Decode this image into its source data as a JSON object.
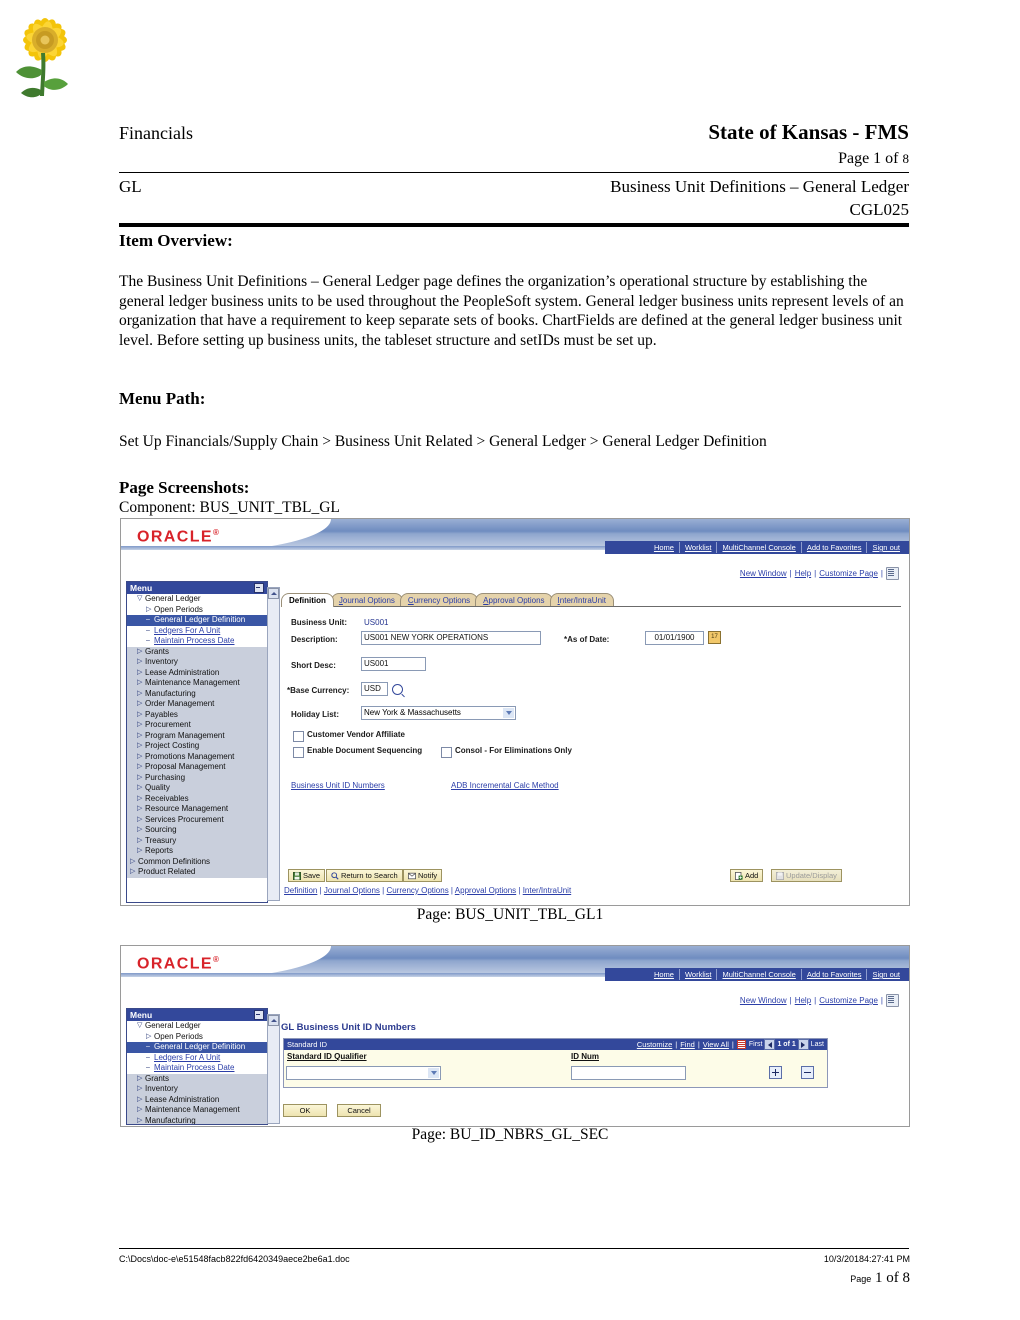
{
  "header": {
    "left_label": "Financials",
    "title": "State of Kansas - FMS",
    "page_of_prefix": "Page",
    "page_of_num": "1",
    "page_of_mid": "of",
    "page_of_total": "8",
    "module": "GL",
    "doc_title": "Business Unit Definitions – General Ledger",
    "doc_code": "CGL025"
  },
  "sections": {
    "item_overview_heading": "Item Overview:",
    "overview_body": "The Business Unit Definitions – General Ledger page defines the organization’s operational structure by establishing the general ledger business units to be used throughout the PeopleSoft system. General ledger business units represent levels of an organization that have a requirement to keep separate sets of books. ChartFields are defined at the general ledger business unit level. Before setting up business units, the tableset structure and setIDs must be set up.",
    "menu_path_heading": "Menu Path:",
    "menu_path": "Set Up Financials/Supply Chain > Business Unit Related > General Ledger > General Ledger Definition",
    "page_screenshots_heading": "Page Screenshots:",
    "component_label": "Component: BUS_UNIT_TBL_GL",
    "caption_1": "Page:     BUS_UNIT_TBL_GL1",
    "caption_2": "Page: BU_ID_NBRS_GL_SEC"
  },
  "peoplesoft": {
    "brand": "ORACLE",
    "brand_mark": "®",
    "nav_links": [
      "Home",
      "Worklist",
      "MultiChannel Console",
      "Add to Favorites",
      "Sign out"
    ],
    "tool_links": [
      "New Window",
      "Help",
      "Customize Page"
    ],
    "http_icon_label": "http",
    "menu_title": "Menu",
    "menu_items": [
      {
        "label": "General Ledger",
        "twisty": "▽",
        "indent": 1,
        "state": "open"
      },
      {
        "label": "Open Periods",
        "twisty": "▷",
        "indent": 2,
        "state": "normal"
      },
      {
        "label": "General Ledger Definition",
        "twisty": "–",
        "indent": 2,
        "state": "selected"
      },
      {
        "label": "Ledgers For A Unit",
        "twisty": "–",
        "indent": 2,
        "state": "link"
      },
      {
        "label": "Maintain Process Date",
        "twisty": "–",
        "indent": 2,
        "state": "link"
      },
      {
        "label": "Grants",
        "twisty": "▷",
        "indent": 1,
        "state": "grey"
      },
      {
        "label": "Inventory",
        "twisty": "▷",
        "indent": 1,
        "state": "grey"
      },
      {
        "label": "Lease Administration",
        "twisty": "▷",
        "indent": 1,
        "state": "grey"
      },
      {
        "label": "Maintenance Management",
        "twisty": "▷",
        "indent": 1,
        "state": "grey"
      },
      {
        "label": "Manufacturing",
        "twisty": "▷",
        "indent": 1,
        "state": "grey"
      },
      {
        "label": "Order Management",
        "twisty": "▷",
        "indent": 1,
        "state": "grey"
      },
      {
        "label": "Payables",
        "twisty": "▷",
        "indent": 1,
        "state": "grey"
      },
      {
        "label": "Procurement",
        "twisty": "▷",
        "indent": 1,
        "state": "grey"
      },
      {
        "label": "Program Management",
        "twisty": "▷",
        "indent": 1,
        "state": "grey"
      },
      {
        "label": "Project Costing",
        "twisty": "▷",
        "indent": 1,
        "state": "grey"
      },
      {
        "label": "Promotions Management",
        "twisty": "▷",
        "indent": 1,
        "state": "grey"
      },
      {
        "label": "Proposal Management",
        "twisty": "▷",
        "indent": 1,
        "state": "grey"
      },
      {
        "label": "Purchasing",
        "twisty": "▷",
        "indent": 1,
        "state": "grey"
      },
      {
        "label": "Quality",
        "twisty": "▷",
        "indent": 1,
        "state": "grey"
      },
      {
        "label": "Receivables",
        "twisty": "▷",
        "indent": 1,
        "state": "grey"
      },
      {
        "label": "Resource Management",
        "twisty": "▷",
        "indent": 1,
        "state": "grey"
      },
      {
        "label": "Services Procurement",
        "twisty": "▷",
        "indent": 1,
        "state": "grey"
      },
      {
        "label": "Sourcing",
        "twisty": "▷",
        "indent": 1,
        "state": "grey"
      },
      {
        "label": "Treasury",
        "twisty": "▷",
        "indent": 1,
        "state": "grey"
      },
      {
        "label": "Reports",
        "twisty": "▷",
        "indent": 1,
        "state": "grey"
      },
      {
        "label": "Common Definitions",
        "twisty": "▷",
        "indent": 0,
        "state": "grey"
      },
      {
        "label": "Product Related",
        "twisty": "▷",
        "indent": 0,
        "state": "grey"
      }
    ],
    "menu_items_short": [
      {
        "label": "General Ledger",
        "twisty": "▽",
        "indent": 1,
        "state": "open"
      },
      {
        "label": "Open Periods",
        "twisty": "▷",
        "indent": 2,
        "state": "normal"
      },
      {
        "label": "General Ledger Definition",
        "twisty": "–",
        "indent": 2,
        "state": "selected"
      },
      {
        "label": "Ledgers For A Unit",
        "twisty": "–",
        "indent": 2,
        "state": "link"
      },
      {
        "label": "Maintain Process Date",
        "twisty": "–",
        "indent": 2,
        "state": "link"
      },
      {
        "label": "Grants",
        "twisty": "▷",
        "indent": 1,
        "state": "grey"
      },
      {
        "label": "Inventory",
        "twisty": "▷",
        "indent": 1,
        "state": "grey"
      },
      {
        "label": "Lease Administration",
        "twisty": "▷",
        "indent": 1,
        "state": "grey"
      },
      {
        "label": "Maintenance Management",
        "twisty": "▷",
        "indent": 1,
        "state": "grey"
      },
      {
        "label": "Manufacturing",
        "twisty": "▷",
        "indent": 1,
        "state": "grey"
      }
    ]
  },
  "definition_page": {
    "tabs": [
      {
        "label": "Definition",
        "accel": "D",
        "active": true
      },
      {
        "label": "Journal Options",
        "accel": "J",
        "active": false
      },
      {
        "label": "Currency Options",
        "accel": "C",
        "active": false
      },
      {
        "label": "Approval Options",
        "accel": "A",
        "active": false
      },
      {
        "label": "Inter/IntraUnit",
        "accel": "I",
        "active": false
      }
    ],
    "fields": {
      "business_unit_label": "Business Unit:",
      "business_unit_value": "US001",
      "description_label": "Description:",
      "description_value": "US001 NEW YORK OPERATIONS",
      "as_of_date_label": "*As of Date:",
      "as_of_date_value": "01/01/1900",
      "short_desc_label": "Short Desc:",
      "short_desc_value": "US001",
      "base_currency_label": "*Base Currency:",
      "base_currency_value": "USD",
      "holiday_list_label": "Holiday List:",
      "holiday_list_value": "New York & Massachusetts"
    },
    "checkboxes": [
      {
        "label": "Customer Vendor Affiliate",
        "checked": false
      },
      {
        "label": "Enable Document Sequencing",
        "checked": false
      },
      {
        "label": "Consol - For Eliminations Only",
        "checked": false
      }
    ],
    "page_links": [
      "Business Unit ID Numbers",
      "ADB Incremental Calc Method"
    ],
    "buttons": [
      {
        "label": "Save",
        "icon": "save-icon",
        "disabled": false
      },
      {
        "label": "Return to Search",
        "icon": "search-icon",
        "disabled": false
      },
      {
        "label": "Notify",
        "icon": "notify-icon",
        "disabled": false
      }
    ],
    "right_buttons": [
      {
        "label": "Add",
        "icon": "add-icon",
        "disabled": false
      },
      {
        "label": "Update/Display",
        "icon": "update-icon",
        "disabled": true
      }
    ],
    "footer_links": [
      "Definition",
      "Journal Options",
      "Currency Options",
      "Approval Options",
      "Inter/IntraUnit"
    ]
  },
  "id_numbers_page": {
    "title": "GL Business Unit ID Numbers",
    "grid_header_label": "Standard ID",
    "grid_actions": [
      "Customize",
      "Find",
      "View All"
    ],
    "grid_icon": "grid-download-icon",
    "nav_first": "First",
    "nav_counter": "1 of 1",
    "nav_last": "Last",
    "columns": [
      "Standard ID Qualifier",
      "ID Num"
    ],
    "qualifier_value": "",
    "idnum_value": "",
    "row_add": "+",
    "row_remove": "–",
    "buttons": [
      "OK",
      "Cancel"
    ]
  },
  "footer": {
    "path": "C:\\Docs\\doc-e\\e51548facb822fd6420349aece2be6a1.doc",
    "timestamp": "10/3/20184:27:41 PM",
    "page_prefix": "Page",
    "page_num": "1",
    "page_mid": "of",
    "page_total": "8"
  },
  "colors": {
    "oracle_red": "#d8232a",
    "ps_navy": "#33489b",
    "ps_selected": "#3a56a5",
    "link_blue": "#2b3ea8",
    "tab_tan": "#e5d3ab",
    "btn_yellow": "#f7efc6"
  }
}
